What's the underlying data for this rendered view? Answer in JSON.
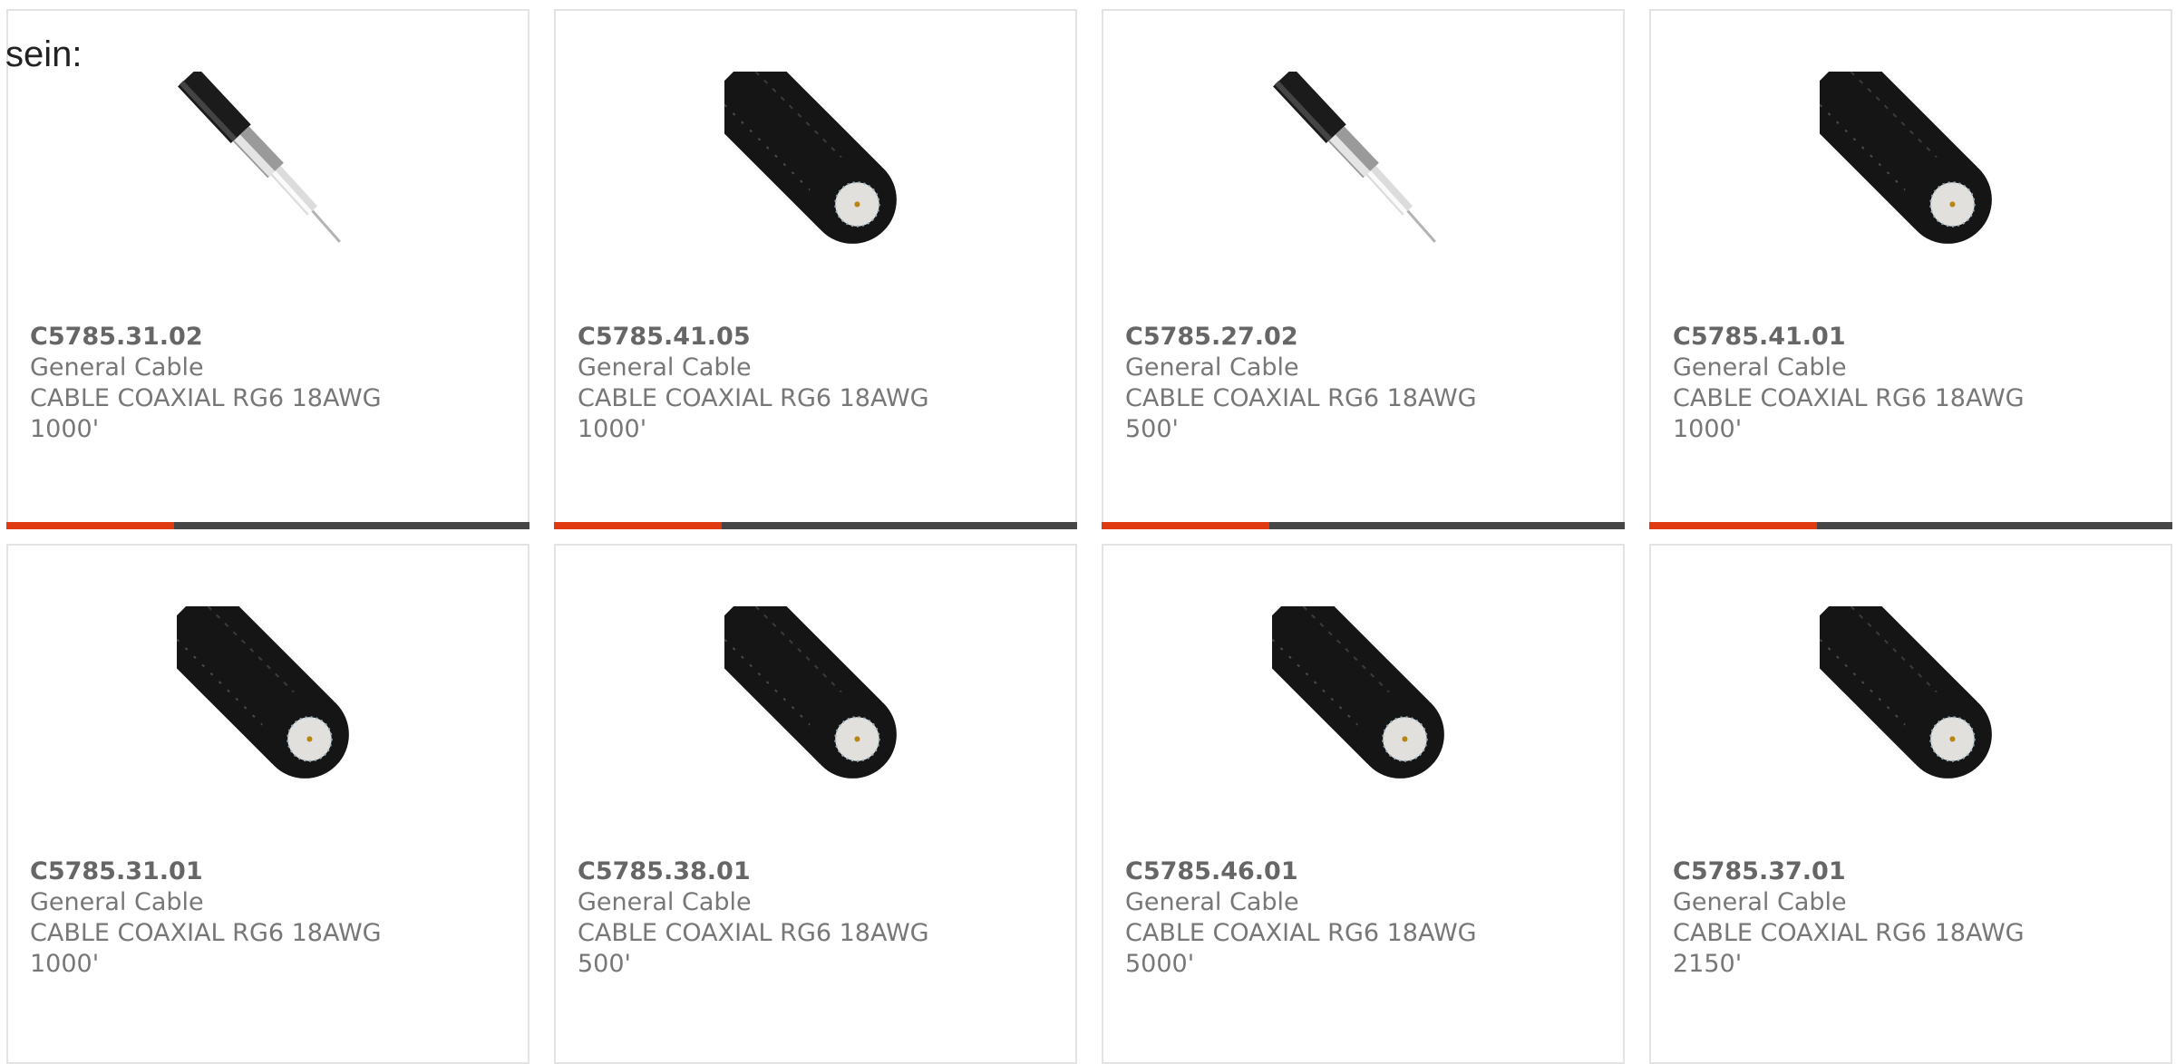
{
  "intro_text": "sein:",
  "colors": {
    "accent": "#e03a12",
    "bar_track": "#464646",
    "border": "#e3e3e3",
    "text": "#777777"
  },
  "products": [
    {
      "part_number": "C5785.31.02",
      "manufacturer": "General Cable",
      "description": "CABLE COAXIAL RG6 18AWG 1000'",
      "image": "coax-cable-stripped-icon",
      "progress": 0.32
    },
    {
      "part_number": "C5785.41.05",
      "manufacturer": "General Cable",
      "description": "CABLE COAXIAL RG6 18AWG 1000'",
      "image": "coax-cable-end-icon",
      "progress": 0.32
    },
    {
      "part_number": "C5785.27.02",
      "manufacturer": "General Cable",
      "description": "CABLE COAXIAL RG6 18AWG 500'",
      "image": "coax-cable-stripped-icon",
      "progress": 0.32
    },
    {
      "part_number": "C5785.41.01",
      "manufacturer": "General Cable",
      "description": "CABLE COAXIAL RG6 18AWG 1000'",
      "image": "coax-cable-end-icon",
      "progress": 0.32
    },
    {
      "part_number": "C5785.31.01",
      "manufacturer": "General Cable",
      "description": "CABLE COAXIAL RG6 18AWG 1000'",
      "image": "coax-cable-end-icon"
    },
    {
      "part_number": "C5785.38.01",
      "manufacturer": "General Cable",
      "description": "CABLE COAXIAL RG6 18AWG 500'",
      "image": "coax-cable-end-icon"
    },
    {
      "part_number": "C5785.46.01",
      "manufacturer": "General Cable",
      "description": "CABLE COAXIAL RG6 18AWG 5000'",
      "image": "coax-cable-end-icon"
    },
    {
      "part_number": "C5785.37.01",
      "manufacturer": "General Cable",
      "description": "CABLE COAXIAL RG6 18AWG 2150'",
      "image": "coax-cable-end-icon"
    }
  ]
}
